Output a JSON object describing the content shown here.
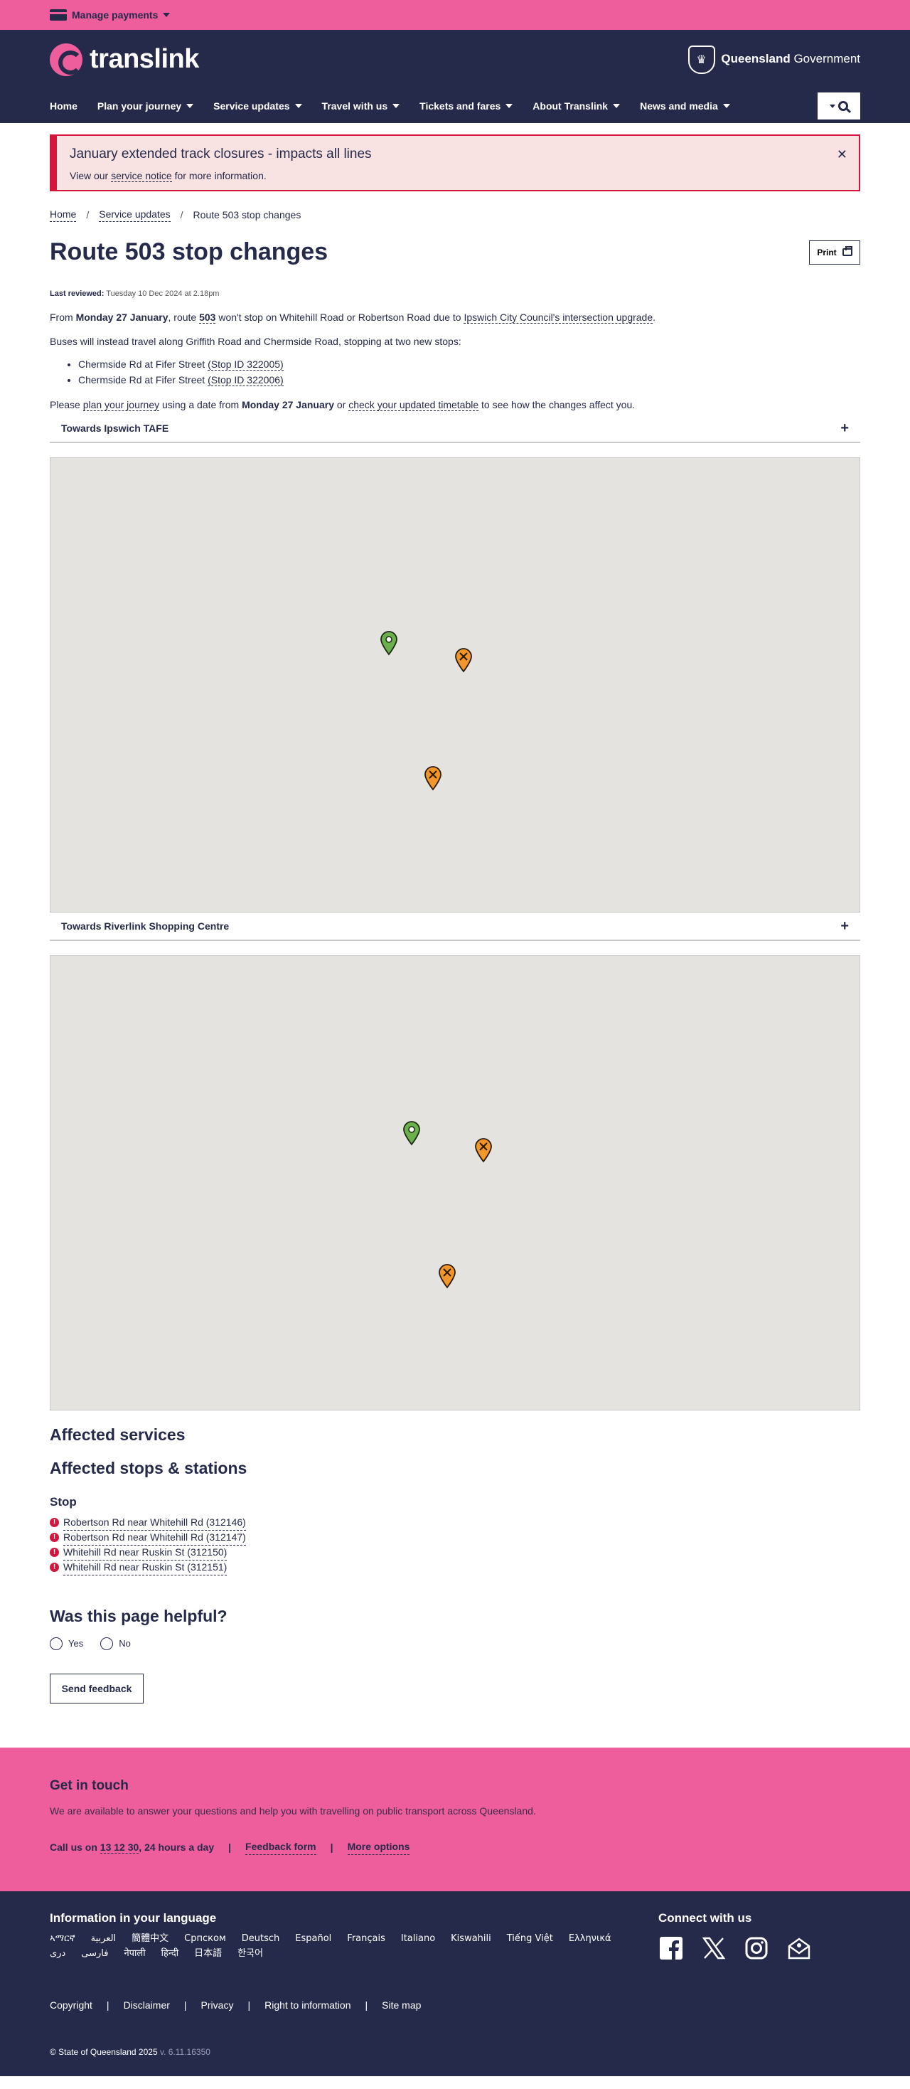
{
  "topbar": {
    "manage_payments": "Manage payments"
  },
  "header": {
    "logo_text": "translink",
    "gov_bold": "Queensland",
    "gov_text": "Government",
    "nav": [
      "Home",
      "Plan your journey",
      "Service updates",
      "Travel with us",
      "Tickets and fares",
      "About Translink",
      "News and media"
    ]
  },
  "alert": {
    "title": "January extended track closures - impacts all lines",
    "body_prefix": "View our ",
    "body_link": "service notice",
    "body_suffix": " for more information."
  },
  "breadcrumb": [
    "Home",
    "Service updates",
    "Route 503 stop changes"
  ],
  "page": {
    "title": "Route 503 stop changes",
    "print_label": "Print",
    "last_reviewed_label": "Last reviewed:",
    "last_reviewed_value": "Tuesday 10 Dec 2024 at 2.18pm",
    "p1": {
      "t1": "From ",
      "b1": "Monday 27 January",
      "t2": ", route ",
      "route_link": "503",
      "t3": " won't stop on Whitehill Road or Robertson Road due to ",
      "link": "Ipswich City Council's intersection upgrade",
      "t4": "."
    },
    "p2": "Buses will instead travel along Griffith Road and Chermside Road, stopping at two new stops:",
    "new_stops": [
      {
        "name": "Chermside Rd at Fifer Street ",
        "link": "(Stop ID 322005)"
      },
      {
        "name": "Chermside Rd at Fifer Street ",
        "link": "(Stop ID 322006)"
      }
    ],
    "p3": {
      "t1": "Please ",
      "link1": "plan your journey",
      "t2": " using a date from ",
      "b1": "Monday 27 January",
      "t3": " or ",
      "link2": "check your updated timetable",
      "t4": " to see how the changes affect you."
    },
    "accordions": [
      "Towards Ipswich TAFE",
      "Towards Riverlink Shopping Centre"
    ],
    "affected_services_heading": "Affected services",
    "affected_stops_heading": "Affected stops & stations",
    "stop_label": "Stop",
    "affected_stops": [
      "Robertson Rd near Whitehill Rd (312146)",
      "Robertson Rd near Whitehill Rd (312147)",
      "Whitehill Rd near Ruskin St (312150)",
      "Whitehill Rd near Ruskin St (312151)"
    ],
    "helpful_heading": "Was this page helpful?",
    "helpful_yes": "Yes",
    "helpful_no": "No",
    "feedback_button": "Send feedback"
  },
  "contact": {
    "heading": "Get in touch",
    "body": "We are available to answer your questions and help you with travelling on public transport across Queensland.",
    "call_prefix": "Call us on ",
    "call_number": "13 12 30",
    "call_suffix": ", 24 hours a day",
    "feedback_link": "Feedback form",
    "more_link": "More options"
  },
  "footer": {
    "lang_heading": "Information in your language",
    "languages": [
      "ኣማርኛ",
      "العربية",
      "簡體中文",
      "Српском",
      "Deutsch",
      "Español",
      "Français",
      "Italiano",
      "Kiswahili",
      "Tiếng Việt",
      "Ελληνικά",
      "دری",
      "فارسی",
      "नेपाली",
      "हिन्दी",
      "日本語",
      "한국어"
    ],
    "connect_heading": "Connect with us",
    "links": [
      "Copyright",
      "Disclaimer",
      "Privacy",
      "Right to information",
      "Site map"
    ],
    "copyright": "© State of Queensland 2025",
    "version": "v. 6.11.16350"
  },
  "colors": {
    "brand_pink": "#ee5d9c",
    "navy": "#262a4a",
    "alert_red": "#d5153b",
    "pin_green": "#6ab04c",
    "pin_orange": "#f0962a"
  }
}
